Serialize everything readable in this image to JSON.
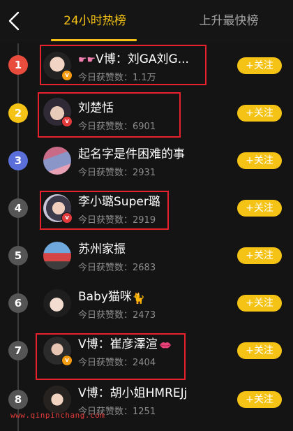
{
  "header": {
    "tabs": [
      {
        "label": "24小时热榜",
        "active": true
      },
      {
        "label": "上升最快榜",
        "active": false
      }
    ]
  },
  "colors": {
    "accent": "#f5c315",
    "highlight_box": "#e8222c",
    "rank_1": "#e84c3d",
    "rank_2": "#f5c315",
    "rank_3": "#5b6fdb",
    "rank_other": "#555555",
    "verified_orange": "#f39c12",
    "verified_red": "#e33b3b"
  },
  "list": {
    "items": [
      {
        "rank": "1",
        "name": "V博：刘GA刘G...",
        "name_prefix_icons": [
          "pointing-hand-icon",
          "pointing-hand-icon"
        ],
        "likes": "今日获赞数：1.1万",
        "follow": "+关注",
        "badge": "orange"
      },
      {
        "rank": "2",
        "name": "刘楚恬",
        "likes": "今日获赞数：6901",
        "follow": "+关注",
        "badge": "red"
      },
      {
        "rank": "3",
        "name": "起名字是件困难的事",
        "likes": "今日获赞数：2931",
        "follow": "+关注",
        "badge": ""
      },
      {
        "rank": "4",
        "name": "李小璐Super璐",
        "likes": "今日获赞数：2919",
        "follow": "+关注",
        "badge": "red"
      },
      {
        "rank": "5",
        "name": "苏州家振",
        "likes": "今日获赞数：2683",
        "follow": "+关注",
        "badge": ""
      },
      {
        "rank": "6",
        "name": "Baby猫咪",
        "name_suffix_icon": "cat-icon",
        "likes": "今日获赞数：2473",
        "follow": "+关注",
        "badge": ""
      },
      {
        "rank": "7",
        "name": "V博：崔彦澤渲",
        "name_suffix_icon": "lips-icon",
        "likes": "今日获赞数：2404",
        "follow": "+关注",
        "badge": "orange"
      },
      {
        "rank": "8",
        "name": "V博：胡小姐HMREJj",
        "likes": "今日获赞数：1251",
        "follow": "+关注",
        "badge": ""
      }
    ]
  },
  "watermark": "www.qinpinchang.com"
}
